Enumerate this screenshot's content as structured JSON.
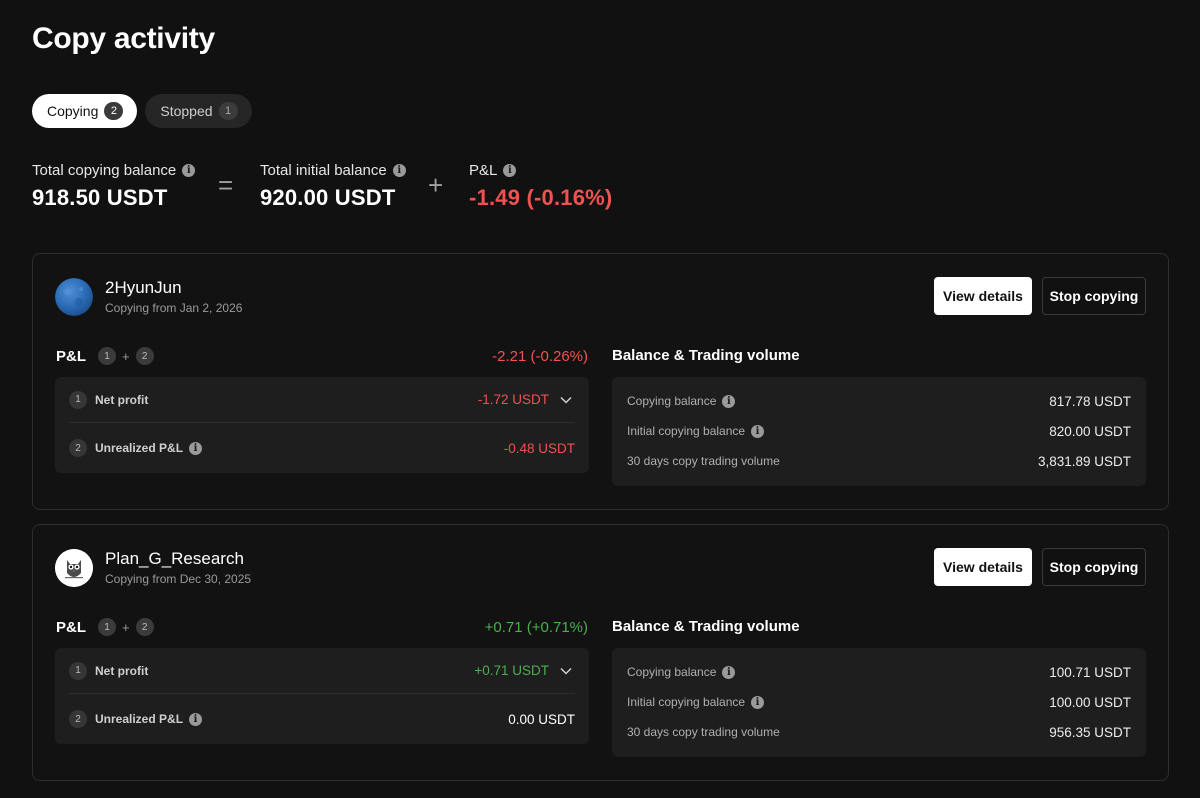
{
  "page": {
    "title": "Copy activity"
  },
  "tabs": [
    {
      "label": "Copying",
      "count": "2",
      "active": true
    },
    {
      "label": "Stopped",
      "count": "1",
      "active": false
    }
  ],
  "summary": {
    "total_copying_balance": {
      "label": "Total copying balance",
      "value": "918.50 USDT"
    },
    "equals": "=",
    "total_initial_balance": {
      "label": "Total initial balance",
      "value": "920.00 USDT"
    },
    "plus": "+",
    "pnl": {
      "label": "P&L",
      "value": "-1.49 (-0.16%)"
    }
  },
  "colors": {
    "negative": "#ef5350",
    "positive": "#4caf50",
    "background": "#111111"
  },
  "cards": [
    {
      "trader": "2HyunJun",
      "since": "Copying from Jan 2, 2026",
      "avatar": "blue-textured-avatar",
      "view_label": "View details",
      "stop_label": "Stop copying",
      "pnl_title": "P&L",
      "badge1": "1",
      "plus": "+",
      "badge2": "2",
      "pnl_total": "-2.21 (-0.26%)",
      "pnl_tone": "neg",
      "net_profit_num": "1",
      "net_profit_label": "Net profit",
      "net_profit_value": "-1.72 USDT",
      "net_profit_tone": "neg",
      "unrealized_num": "2",
      "unrealized_label": "Unrealized P&L",
      "unrealized_value": "-0.48 USDT",
      "unrealized_tone": "neg",
      "balance_title": "Balance & Trading volume",
      "copying_balance_label": "Copying balance",
      "copying_balance_value": "817.78 USDT",
      "initial_balance_label": "Initial copying balance",
      "initial_balance_value": "820.00 USDT",
      "volume_label": "30 days copy trading volume",
      "volume_value": "3,831.89 USDT"
    },
    {
      "trader": "Plan_G_Research",
      "since": "Copying from Dec 30, 2025",
      "avatar": "owl-avatar",
      "view_label": "View details",
      "stop_label": "Stop copying",
      "pnl_title": "P&L",
      "badge1": "1",
      "plus": "+",
      "badge2": "2",
      "pnl_total": "+0.71 (+0.71%)",
      "pnl_tone": "pos",
      "net_profit_num": "1",
      "net_profit_label": "Net profit",
      "net_profit_value": "+0.71 USDT",
      "net_profit_tone": "pos",
      "unrealized_num": "2",
      "unrealized_label": "Unrealized P&L",
      "unrealized_value": "0.00 USDT",
      "unrealized_tone": "neutral",
      "balance_title": "Balance & Trading volume",
      "copying_balance_label": "Copying balance",
      "copying_balance_value": "100.71 USDT",
      "initial_balance_label": "Initial copying balance",
      "initial_balance_value": "100.00 USDT",
      "volume_label": "30 days copy trading volume",
      "volume_value": "956.35 USDT"
    }
  ]
}
